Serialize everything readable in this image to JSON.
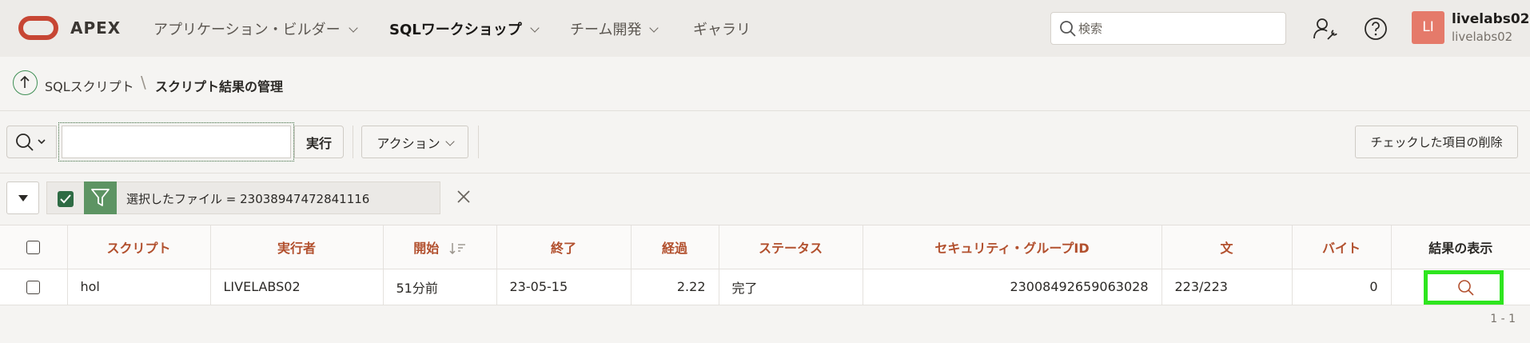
{
  "header": {
    "brand": "APEX",
    "nav": [
      {
        "label": "アプリケーション・ビルダー",
        "active": false
      },
      {
        "label": "SQLワークショップ",
        "active": true
      },
      {
        "label": "チーム開発",
        "active": false
      },
      {
        "label": "ギャラリ",
        "active": false
      }
    ],
    "search_placeholder": "検索",
    "user": {
      "initials": "LI",
      "name": "livelabs02",
      "workspace": "livelabs02"
    }
  },
  "breadcrumb": {
    "parent": "SQLスクリプト",
    "separator": "\\",
    "current": "スクリプト結果の管理"
  },
  "toolbar": {
    "search_value": "",
    "go_label": "実行",
    "actions_label": "アクション",
    "delete_label": "チェックした項目の削除"
  },
  "filter": {
    "text": "選択したファイル = 23038947472841116"
  },
  "table": {
    "columns": [
      "スクリプト",
      "実行者",
      "開始",
      "終了",
      "経過",
      "ステータス",
      "セキュリティ・グループID",
      "文",
      "バイト",
      "結果の表示"
    ],
    "rows": [
      {
        "script": "hol",
        "runner": "LIVELABS02",
        "start": "51分前",
        "end": "23-05-15",
        "elapsed": "2.22",
        "status": "完了",
        "sgid": "23008492659063028",
        "statements": "223/223",
        "bytes": "0"
      }
    ]
  },
  "pagination": "1 - 1",
  "colors": {
    "accent": "#b2502e",
    "brand": "#c74634",
    "highlight": "#2ee51f",
    "filter_green": "#5d9463"
  }
}
